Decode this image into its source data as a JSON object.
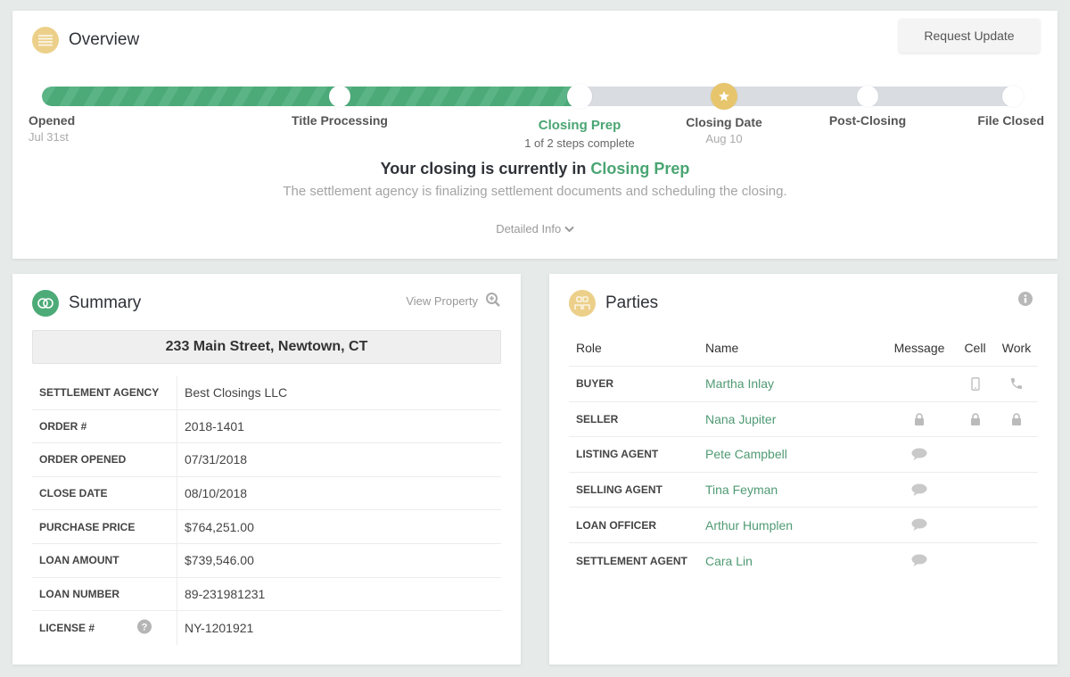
{
  "overview": {
    "title": "Overview",
    "icon": "document-lines-icon",
    "request_button": "Request Update",
    "progress_fraction": 0.546,
    "steps": [
      {
        "label": "Opened",
        "sub": "Jul 31st",
        "state": "complete"
      },
      {
        "label": "Title Processing",
        "sub": "",
        "state": "complete"
      },
      {
        "label": "Closing Prep",
        "sub": "1 of 2 steps complete",
        "state": "current"
      },
      {
        "label": "Closing Date",
        "sub": "Aug 10",
        "state": "milestone"
      },
      {
        "label": "Post-Closing",
        "sub": "",
        "state": "pending"
      },
      {
        "label": "File Closed",
        "sub": "",
        "state": "pending"
      }
    ],
    "status_prefix": "Your closing is currently in",
    "status_stage": "Closing Prep",
    "status_description": "The settlement agency is finalizing settlement documents and scheduling the closing.",
    "detail_link": "Detailed Info"
  },
  "summary": {
    "title": "Summary",
    "icon": "rings-icon",
    "view_property": "View Property",
    "address": "233 Main Street, Newtown, CT",
    "rows": [
      {
        "key": "SETTLEMENT AGENCY",
        "value": "Best Closings LLC"
      },
      {
        "key": "ORDER #",
        "value": "2018-1401"
      },
      {
        "key": "ORDER OPENED",
        "value": "07/31/2018"
      },
      {
        "key": "CLOSE DATE",
        "value": "08/10/2018"
      },
      {
        "key": "PURCHASE PRICE",
        "value": "$764,251.00"
      },
      {
        "key": "LOAN AMOUNT",
        "value": "$739,546.00"
      },
      {
        "key": "LOAN NUMBER",
        "value": "89-231981231"
      },
      {
        "key": "LICENSE #",
        "value": "NY-1201921",
        "help": true
      }
    ]
  },
  "parties": {
    "title": "Parties",
    "icon": "people-icon",
    "headers": {
      "role": "Role",
      "name": "Name",
      "message": "Message",
      "cell": "Cell",
      "work": "Work"
    },
    "rows": [
      {
        "role": "BUYER",
        "name": "Martha Inlay",
        "message": "",
        "cell": "mobile-phone-icon",
        "work": "phone-icon"
      },
      {
        "role": "SELLER",
        "name": "Nana Jupiter",
        "message": "lock-icon",
        "cell": "lock-icon",
        "work": "lock-icon"
      },
      {
        "role": "LISTING AGENT",
        "name": "Pete Campbell",
        "message": "chat-bubble-icon",
        "cell": "",
        "work": ""
      },
      {
        "role": "SELLING AGENT",
        "name": "Tina Feyman",
        "message": "chat-bubble-icon",
        "cell": "",
        "work": ""
      },
      {
        "role": "LOAN OFFICER",
        "name": "Arthur Humplen",
        "message": "chat-bubble-icon",
        "cell": "",
        "work": ""
      },
      {
        "role": "SETTLEMENT AGENT",
        "name": "Cara Lin",
        "message": "chat-bubble-icon",
        "cell": "",
        "work": ""
      }
    ]
  },
  "colors": {
    "accent_green": "#4aa573",
    "gold": "#e6c56c",
    "track_gray": "#d9dce1",
    "name_green": "#4f9a73"
  }
}
